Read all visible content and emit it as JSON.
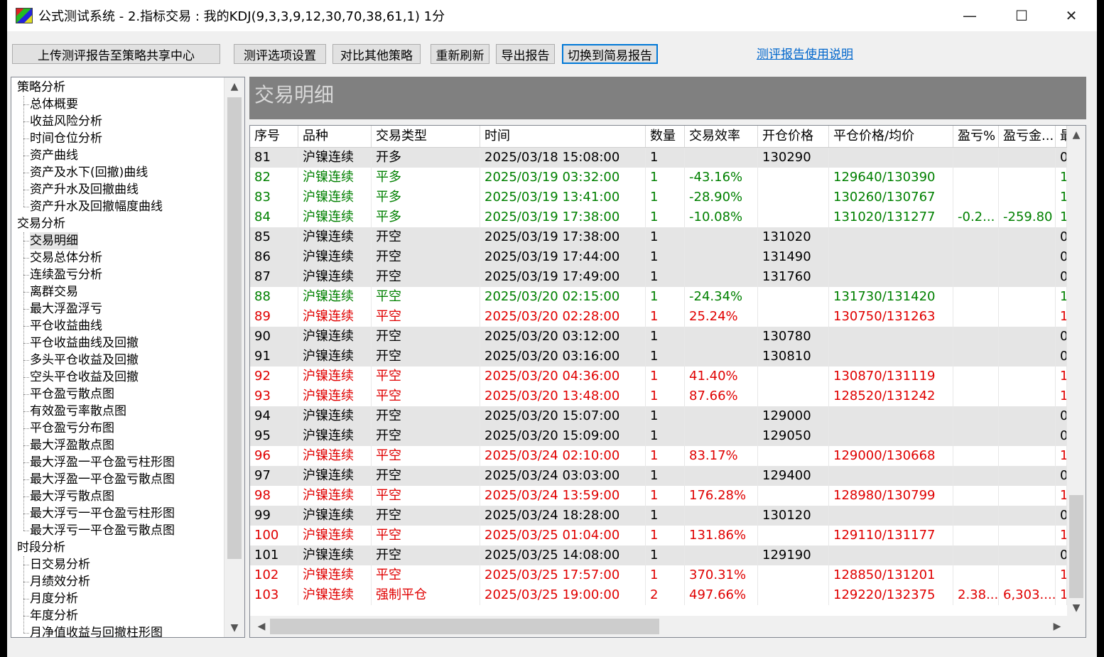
{
  "window": {
    "title": "公式测试系统 - 2.指标交易 : 我的KDJ(9,3,3,9,12,30,70,38,61,1) 1分",
    "minimize": "—",
    "maximize": "☐",
    "close": "✕"
  },
  "toolbar": {
    "upload": "上传测评报告至策略共享中心",
    "options": "测评选项设置",
    "compare": "对比其他策略",
    "refresh": "重新刷新",
    "export": "导出报告",
    "switch_simple": "切换到简易报告",
    "help_link": "测评报告使用说明"
  },
  "tree": {
    "groups": [
      {
        "label": "策略分析",
        "children": [
          "总体概要",
          "收益风险分析",
          "时间仓位分析",
          "资产曲线",
          "资产及水下(回撤)曲线",
          "资产升水及回撤曲线",
          "资产升水及回撤幅度曲线"
        ]
      },
      {
        "label": "交易分析",
        "children": [
          "交易明细",
          "交易总体分析",
          "连续盈亏分析",
          "离群交易",
          "最大浮盈浮亏",
          "平仓收益曲线",
          "平仓收益曲线及回撤",
          "多头平仓收益及回撤",
          "空头平仓收益及回撤",
          "平仓盈亏散点图",
          "有效盈亏率散点图",
          "平仓盈亏分布图",
          "最大浮盈散点图",
          "最大浮盈一平仓盈亏柱形图",
          "最大浮盈一平仓盈亏散点图",
          "最大浮亏散点图",
          "最大浮亏一平仓盈亏柱形图",
          "最大浮亏一平仓盈亏散点图"
        ]
      },
      {
        "label": "时段分析",
        "children": [
          "日交易分析",
          "月绩效分析",
          "月度分析",
          "年度分析",
          "月净值收益与回撤柱形图"
        ]
      }
    ],
    "selected": "交易明细"
  },
  "panel": {
    "title": "交易明细"
  },
  "grid": {
    "columns": [
      "序号",
      "品种",
      "交易类型",
      "时间",
      "数量",
      "交易效率",
      "开仓价格",
      "平仓价格/均价",
      "盈亏%",
      "盈亏金...",
      "最"
    ],
    "rows": [
      {
        "color": "black",
        "cells": [
          "81",
          "沪镍连续",
          "开多",
          "2025/03/18 15:08:00",
          "1",
          "",
          "130290",
          "",
          "",
          "",
          "0"
        ]
      },
      {
        "color": "green",
        "cells": [
          "82",
          "沪镍连续",
          "平多",
          "2025/03/19 03:32:00",
          "1",
          "-43.16%",
          "",
          "129640/130390",
          "",
          "",
          "1"
        ]
      },
      {
        "color": "green",
        "cells": [
          "83",
          "沪镍连续",
          "平多",
          "2025/03/19 13:41:00",
          "1",
          "-28.90%",
          "",
          "130260/130767",
          "",
          "",
          "1"
        ]
      },
      {
        "color": "green",
        "cells": [
          "84",
          "沪镍连续",
          "平多",
          "2025/03/19 17:38:00",
          "1",
          "-10.08%",
          "",
          "131020/131277",
          "-0.2...",
          "-259.80",
          "1"
        ]
      },
      {
        "color": "black",
        "cells": [
          "85",
          "沪镍连续",
          "开空",
          "2025/03/19 17:38:00",
          "1",
          "",
          "131020",
          "",
          "",
          "",
          "0"
        ]
      },
      {
        "color": "black",
        "cells": [
          "86",
          "沪镍连续",
          "开空",
          "2025/03/19 17:44:00",
          "1",
          "",
          "131490",
          "",
          "",
          "",
          "0"
        ]
      },
      {
        "color": "black",
        "cells": [
          "87",
          "沪镍连续",
          "开空",
          "2025/03/19 17:49:00",
          "1",
          "",
          "131760",
          "",
          "",
          "",
          "0"
        ]
      },
      {
        "color": "green",
        "cells": [
          "88",
          "沪镍连续",
          "平空",
          "2025/03/20 02:15:00",
          "1",
          "-24.34%",
          "",
          "131730/131420",
          "",
          "",
          "1"
        ]
      },
      {
        "color": "red",
        "cells": [
          "89",
          "沪镍连续",
          "平空",
          "2025/03/20 02:28:00",
          "1",
          "25.24%",
          "",
          "130750/131263",
          "",
          "",
          "1"
        ]
      },
      {
        "color": "black",
        "cells": [
          "90",
          "沪镍连续",
          "开空",
          "2025/03/20 03:12:00",
          "1",
          "",
          "130780",
          "",
          "",
          "",
          "0"
        ]
      },
      {
        "color": "black",
        "cells": [
          "91",
          "沪镍连续",
          "开空",
          "2025/03/20 03:16:00",
          "1",
          "",
          "130810",
          "",
          "",
          "",
          "0"
        ]
      },
      {
        "color": "red",
        "cells": [
          "92",
          "沪镍连续",
          "平空",
          "2025/03/20 04:36:00",
          "1",
          "41.40%",
          "",
          "130870/131119",
          "",
          "",
          "1"
        ]
      },
      {
        "color": "red",
        "cells": [
          "93",
          "沪镍连续",
          "平空",
          "2025/03/20 13:48:00",
          "1",
          "87.66%",
          "",
          "128520/131242",
          "",
          "",
          "1"
        ]
      },
      {
        "color": "black",
        "cells": [
          "94",
          "沪镍连续",
          "开空",
          "2025/03/20 15:07:00",
          "1",
          "",
          "129000",
          "",
          "",
          "",
          "0"
        ]
      },
      {
        "color": "black",
        "cells": [
          "95",
          "沪镍连续",
          "开空",
          "2025/03/20 15:09:00",
          "1",
          "",
          "129050",
          "",
          "",
          "",
          "0"
        ]
      },
      {
        "color": "red",
        "cells": [
          "96",
          "沪镍连续",
          "平空",
          "2025/03/24 02:10:00",
          "1",
          "83.17%",
          "",
          "129000/130668",
          "",
          "",
          "1"
        ]
      },
      {
        "color": "black",
        "cells": [
          "97",
          "沪镍连续",
          "开空",
          "2025/03/24 03:03:00",
          "1",
          "",
          "129400",
          "",
          "",
          "",
          "0"
        ]
      },
      {
        "color": "red",
        "cells": [
          "98",
          "沪镍连续",
          "平空",
          "2025/03/24 13:59:00",
          "1",
          "176.28%",
          "",
          "128980/130799",
          "",
          "",
          "1"
        ]
      },
      {
        "color": "black",
        "cells": [
          "99",
          "沪镍连续",
          "开空",
          "2025/03/24 18:28:00",
          "1",
          "",
          "130120",
          "",
          "",
          "",
          "0"
        ]
      },
      {
        "color": "red",
        "cells": [
          "100",
          "沪镍连续",
          "平空",
          "2025/03/25 01:04:00",
          "1",
          "131.86%",
          "",
          "129110/131177",
          "",
          "",
          "1"
        ]
      },
      {
        "color": "black",
        "cells": [
          "101",
          "沪镍连续",
          "开空",
          "2025/03/25 14:08:00",
          "1",
          "",
          "129190",
          "",
          "",
          "",
          "0"
        ]
      },
      {
        "color": "red",
        "cells": [
          "102",
          "沪镍连续",
          "平空",
          "2025/03/25 17:57:00",
          "1",
          "370.31%",
          "",
          "128850/131201",
          "",
          "",
          "1"
        ]
      },
      {
        "color": "red",
        "cells": [
          "103",
          "沪镍连续",
          "强制平仓",
          "2025/03/25 19:00:00",
          "2",
          "497.66%",
          "",
          "129220/132375",
          "2.38...",
          "6,303....",
          "1"
        ]
      }
    ]
  },
  "colors": {
    "green": "#008000",
    "red": "#e00000",
    "header_band": "#808080",
    "active_border": "#0078d7",
    "link": "#0066cc"
  }
}
